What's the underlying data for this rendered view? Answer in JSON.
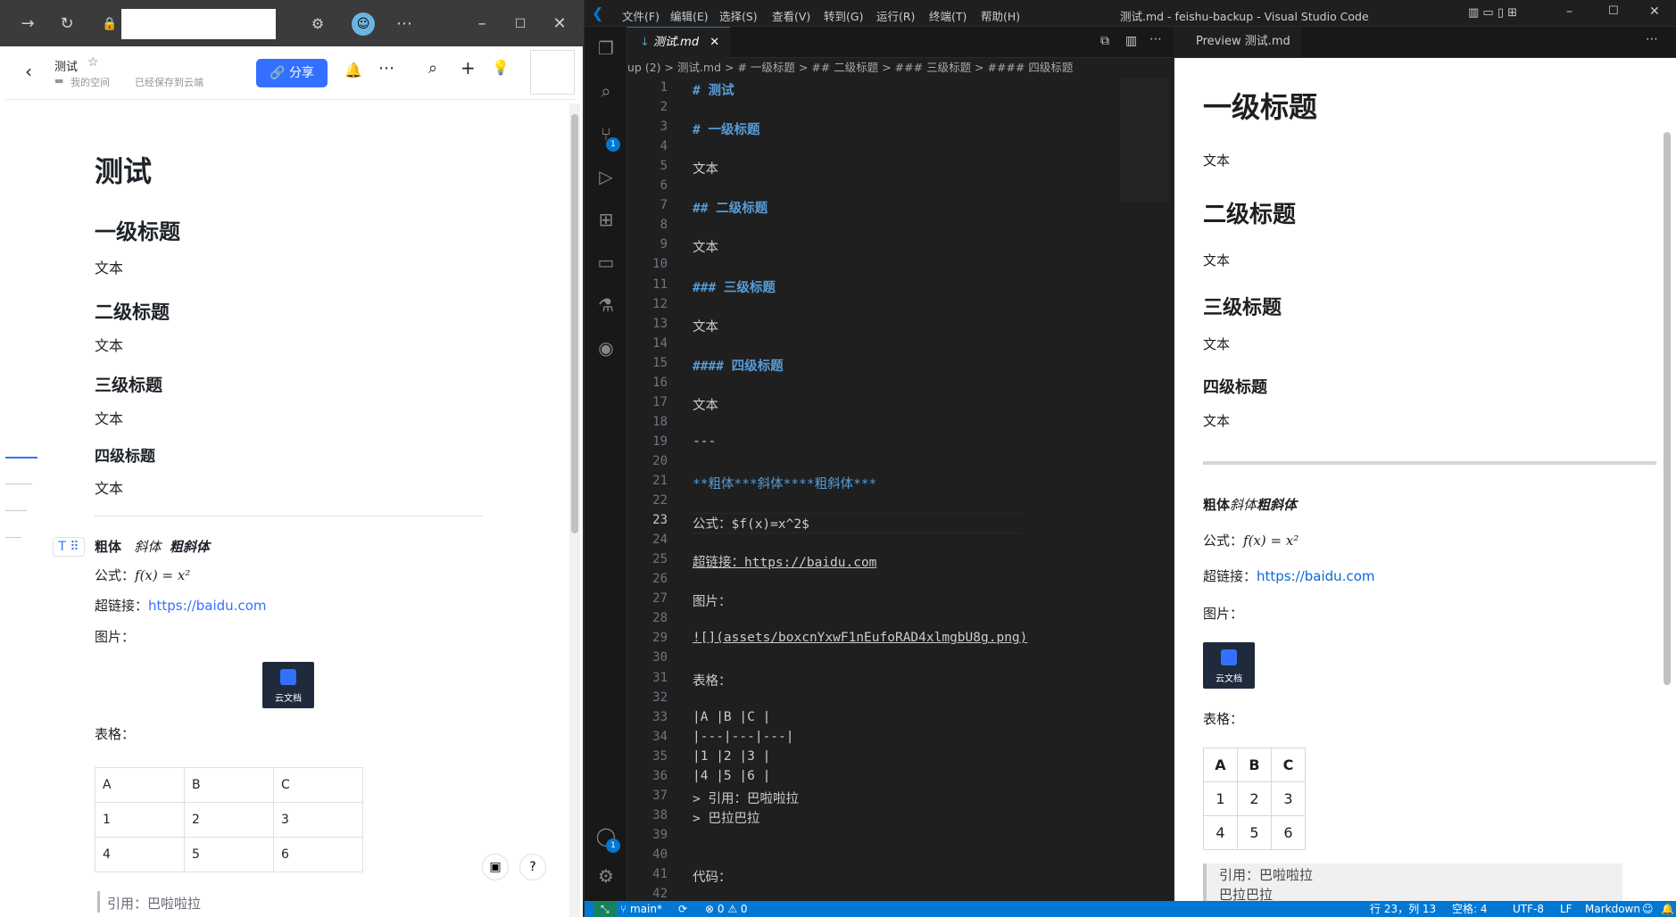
{
  "browser": {
    "tab_icons": [
      "forward-icon",
      "reload-icon",
      "lock-icon",
      "extension-icon",
      "profile-icon",
      "more-icon",
      "minimize-icon",
      "maximize-icon",
      "close-icon"
    ],
    "header": {
      "title": "测试",
      "space": "我的空间",
      "saved": "已经保存到云端",
      "share": "分享"
    },
    "doc": {
      "title": "测试",
      "h1": "一级标题",
      "t1": "文本",
      "h2": "二级标题",
      "t2": "文本",
      "h3": "三级标题",
      "t3": "文本",
      "h4": "四级标题",
      "t4": "文本",
      "bold": "粗体",
      "italic": "斜体",
      "bold_italic": "粗斜体",
      "formula_label": "公式：",
      "formula": "f(x) = x²",
      "link_label": "超链接：",
      "link": "https://baidu.com",
      "image_label": "图片：",
      "image_caption": "云文档",
      "table_label": "表格：",
      "table": [
        [
          "A",
          "B",
          "C"
        ],
        [
          "1",
          "2",
          "3"
        ],
        [
          "4",
          "5",
          "6"
        ]
      ],
      "quote": "引用：巴啦啦拉"
    }
  },
  "vscode": {
    "menu": [
      "文件(F)",
      "编辑(E)",
      "选择(S)",
      "查看(V)",
      "转到(G)",
      "运行(R)",
      "终端(T)",
      "帮助(H)"
    ],
    "title": "测试.md - feishu-backup - Visual Studio Code",
    "tab": "测试.md",
    "breadcrumb": "up (2) > 测试.md > # 一级标题 > ## 二级标题 > ### 三级标题 > #### 四级标题",
    "preview_tab": "Preview 测试.md",
    "lines": [
      {
        "n": "1",
        "t": "# 测试"
      },
      {
        "n": "2",
        "t": ""
      },
      {
        "n": "3",
        "t": "# 一级标题"
      },
      {
        "n": "4",
        "t": ""
      },
      {
        "n": "5",
        "t": "文本"
      },
      {
        "n": "6",
        "t": ""
      },
      {
        "n": "7",
        "t": "## 二级标题"
      },
      {
        "n": "8",
        "t": ""
      },
      {
        "n": "9",
        "t": "文本"
      },
      {
        "n": "10",
        "t": ""
      },
      {
        "n": "11",
        "t": "### 三级标题"
      },
      {
        "n": "12",
        "t": ""
      },
      {
        "n": "13",
        "t": "文本"
      },
      {
        "n": "14",
        "t": ""
      },
      {
        "n": "15",
        "t": "#### 四级标题"
      },
      {
        "n": "16",
        "t": ""
      },
      {
        "n": "17",
        "t": "文本"
      },
      {
        "n": "18",
        "t": ""
      },
      {
        "n": "19",
        "t": "---"
      },
      {
        "n": "20",
        "t": ""
      },
      {
        "n": "21",
        "t": "**粗体***斜体****粗斜体***"
      },
      {
        "n": "22",
        "t": ""
      },
      {
        "n": "23",
        "t": "公式：$f(x)=x^2$"
      },
      {
        "n": "24",
        "t": ""
      },
      {
        "n": "25",
        "t": "超链接：https://baidu.com"
      },
      {
        "n": "26",
        "t": ""
      },
      {
        "n": "27",
        "t": "图片："
      },
      {
        "n": "28",
        "t": ""
      },
      {
        "n": "29",
        "t": "![](assets/boxcnYxwF1nEufoRAD4xlmgbU8g.png)"
      },
      {
        "n": "30",
        "t": ""
      },
      {
        "n": "31",
        "t": "表格："
      },
      {
        "n": "32",
        "t": ""
      },
      {
        "n": "33",
        "t": "|A |B |C |"
      },
      {
        "n": "34",
        "t": "|---|---|---|"
      },
      {
        "n": "35",
        "t": "|1 |2 |3 |"
      },
      {
        "n": "36",
        "t": "|4 |5 |6 |"
      },
      {
        "n": "37",
        "t": "> 引用：巴啦啦拉"
      },
      {
        "n": "38",
        "t": "> 巴拉巴拉"
      },
      {
        "n": "39",
        "t": ""
      },
      {
        "n": "40",
        "t": ""
      },
      {
        "n": "41",
        "t": "代码："
      },
      {
        "n": "42",
        "t": ""
      }
    ],
    "preview": {
      "h1": "一级标题",
      "t1": "文本",
      "h2": "二级标题",
      "t2": "文本",
      "h3": "三级标题",
      "t3": "文本",
      "h4": "四级标题",
      "t4": "文本",
      "bold": "粗体",
      "italic": "斜体",
      "bold_italic": "粗斜体",
      "formula_label": "公式：",
      "formula": "f(x) = x²",
      "link_label": "超链接：",
      "link": "https://baidu.com",
      "image_label": "图片：",
      "image_caption": "云文档",
      "table_label": "表格：",
      "table": [
        [
          "A",
          "B",
          "C"
        ],
        [
          "1",
          "2",
          "3"
        ],
        [
          "4",
          "5",
          "6"
        ]
      ],
      "quote1": "引用：巴啦啦拉",
      "quote2": "巴拉巴拉"
    },
    "status": {
      "branch": "main*",
      "errors": "0",
      "warnings": "0",
      "position": "行 23，列 13",
      "spaces": "空格: 4",
      "encoding": "UTF-8",
      "eol": "LF",
      "language": "Markdown"
    },
    "colors": {
      "accent": "#0078d4",
      "heading": "#569cd6",
      "link": "#3370ff"
    }
  }
}
